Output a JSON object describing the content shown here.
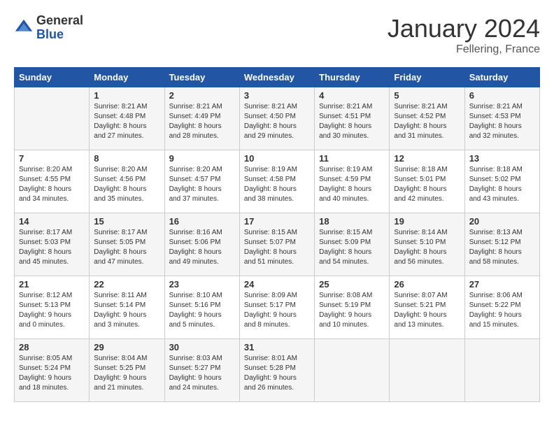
{
  "header": {
    "logo_general": "General",
    "logo_blue": "Blue",
    "title": "January 2024",
    "location": "Fellering, France"
  },
  "days_of_week": [
    "Sunday",
    "Monday",
    "Tuesday",
    "Wednesday",
    "Thursday",
    "Friday",
    "Saturday"
  ],
  "weeks": [
    [
      {
        "day": "",
        "info": ""
      },
      {
        "day": "1",
        "info": "Sunrise: 8:21 AM\nSunset: 4:48 PM\nDaylight: 8 hours\nand 27 minutes."
      },
      {
        "day": "2",
        "info": "Sunrise: 8:21 AM\nSunset: 4:49 PM\nDaylight: 8 hours\nand 28 minutes."
      },
      {
        "day": "3",
        "info": "Sunrise: 8:21 AM\nSunset: 4:50 PM\nDaylight: 8 hours\nand 29 minutes."
      },
      {
        "day": "4",
        "info": "Sunrise: 8:21 AM\nSunset: 4:51 PM\nDaylight: 8 hours\nand 30 minutes."
      },
      {
        "day": "5",
        "info": "Sunrise: 8:21 AM\nSunset: 4:52 PM\nDaylight: 8 hours\nand 31 minutes."
      },
      {
        "day": "6",
        "info": "Sunrise: 8:21 AM\nSunset: 4:53 PM\nDaylight: 8 hours\nand 32 minutes."
      }
    ],
    [
      {
        "day": "7",
        "info": "Sunrise: 8:20 AM\nSunset: 4:55 PM\nDaylight: 8 hours\nand 34 minutes."
      },
      {
        "day": "8",
        "info": "Sunrise: 8:20 AM\nSunset: 4:56 PM\nDaylight: 8 hours\nand 35 minutes."
      },
      {
        "day": "9",
        "info": "Sunrise: 8:20 AM\nSunset: 4:57 PM\nDaylight: 8 hours\nand 37 minutes."
      },
      {
        "day": "10",
        "info": "Sunrise: 8:19 AM\nSunset: 4:58 PM\nDaylight: 8 hours\nand 38 minutes."
      },
      {
        "day": "11",
        "info": "Sunrise: 8:19 AM\nSunset: 4:59 PM\nDaylight: 8 hours\nand 40 minutes."
      },
      {
        "day": "12",
        "info": "Sunrise: 8:18 AM\nSunset: 5:01 PM\nDaylight: 8 hours\nand 42 minutes."
      },
      {
        "day": "13",
        "info": "Sunrise: 8:18 AM\nSunset: 5:02 PM\nDaylight: 8 hours\nand 43 minutes."
      }
    ],
    [
      {
        "day": "14",
        "info": "Sunrise: 8:17 AM\nSunset: 5:03 PM\nDaylight: 8 hours\nand 45 minutes."
      },
      {
        "day": "15",
        "info": "Sunrise: 8:17 AM\nSunset: 5:05 PM\nDaylight: 8 hours\nand 47 minutes."
      },
      {
        "day": "16",
        "info": "Sunrise: 8:16 AM\nSunset: 5:06 PM\nDaylight: 8 hours\nand 49 minutes."
      },
      {
        "day": "17",
        "info": "Sunrise: 8:15 AM\nSunset: 5:07 PM\nDaylight: 8 hours\nand 51 minutes."
      },
      {
        "day": "18",
        "info": "Sunrise: 8:15 AM\nSunset: 5:09 PM\nDaylight: 8 hours\nand 54 minutes."
      },
      {
        "day": "19",
        "info": "Sunrise: 8:14 AM\nSunset: 5:10 PM\nDaylight: 8 hours\nand 56 minutes."
      },
      {
        "day": "20",
        "info": "Sunrise: 8:13 AM\nSunset: 5:12 PM\nDaylight: 8 hours\nand 58 minutes."
      }
    ],
    [
      {
        "day": "21",
        "info": "Sunrise: 8:12 AM\nSunset: 5:13 PM\nDaylight: 9 hours\nand 0 minutes."
      },
      {
        "day": "22",
        "info": "Sunrise: 8:11 AM\nSunset: 5:14 PM\nDaylight: 9 hours\nand 3 minutes."
      },
      {
        "day": "23",
        "info": "Sunrise: 8:10 AM\nSunset: 5:16 PM\nDaylight: 9 hours\nand 5 minutes."
      },
      {
        "day": "24",
        "info": "Sunrise: 8:09 AM\nSunset: 5:17 PM\nDaylight: 9 hours\nand 8 minutes."
      },
      {
        "day": "25",
        "info": "Sunrise: 8:08 AM\nSunset: 5:19 PM\nDaylight: 9 hours\nand 10 minutes."
      },
      {
        "day": "26",
        "info": "Sunrise: 8:07 AM\nSunset: 5:21 PM\nDaylight: 9 hours\nand 13 minutes."
      },
      {
        "day": "27",
        "info": "Sunrise: 8:06 AM\nSunset: 5:22 PM\nDaylight: 9 hours\nand 15 minutes."
      }
    ],
    [
      {
        "day": "28",
        "info": "Sunrise: 8:05 AM\nSunset: 5:24 PM\nDaylight: 9 hours\nand 18 minutes."
      },
      {
        "day": "29",
        "info": "Sunrise: 8:04 AM\nSunset: 5:25 PM\nDaylight: 9 hours\nand 21 minutes."
      },
      {
        "day": "30",
        "info": "Sunrise: 8:03 AM\nSunset: 5:27 PM\nDaylight: 9 hours\nand 24 minutes."
      },
      {
        "day": "31",
        "info": "Sunrise: 8:01 AM\nSunset: 5:28 PM\nDaylight: 9 hours\nand 26 minutes."
      },
      {
        "day": "",
        "info": ""
      },
      {
        "day": "",
        "info": ""
      },
      {
        "day": "",
        "info": ""
      }
    ]
  ]
}
